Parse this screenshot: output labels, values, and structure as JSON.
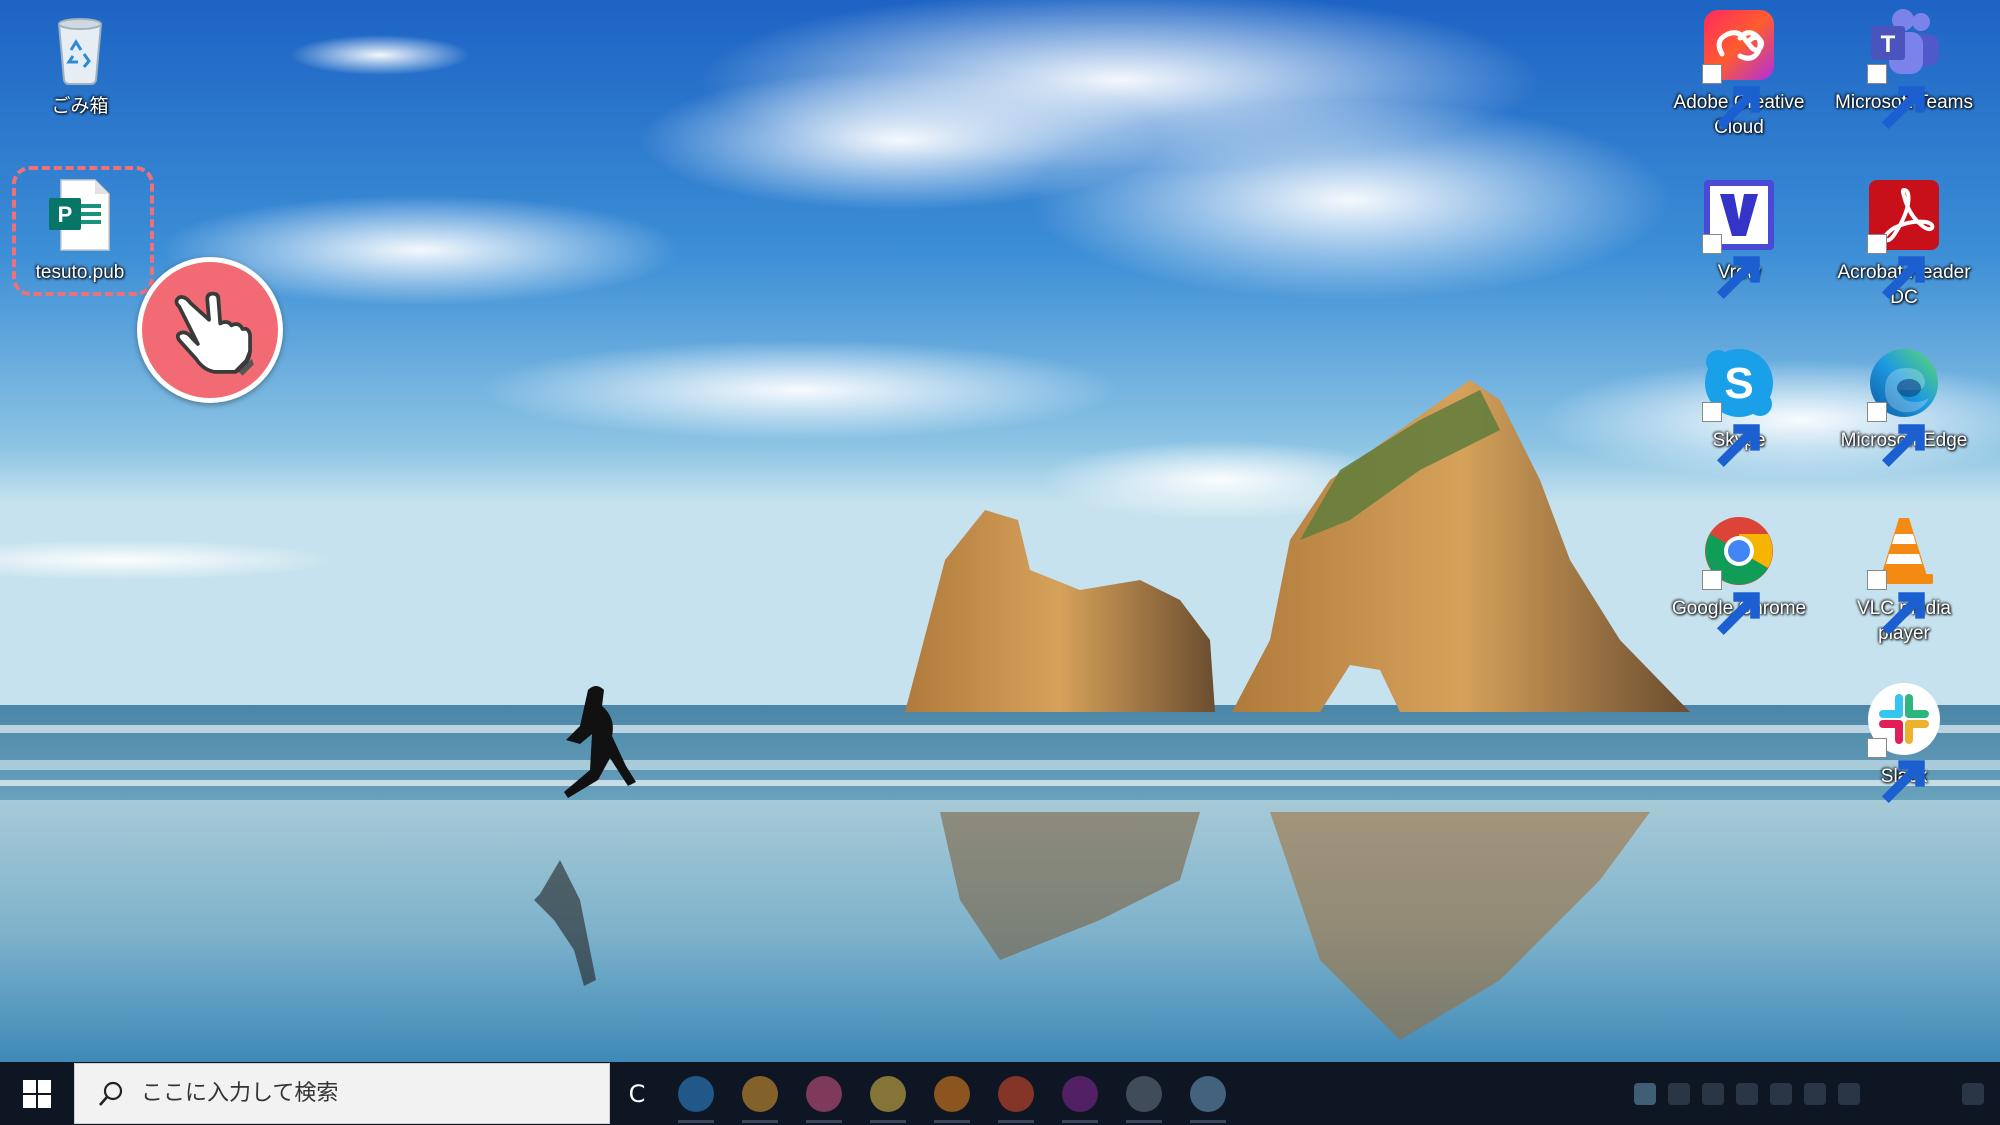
{
  "desktop": {
    "icons_left": [
      {
        "name": "recycle-bin",
        "label": "ごみ箱"
      },
      {
        "name": "tesuto-pub",
        "label": "tesuto.pub"
      }
    ],
    "icons_right": [
      {
        "name": "adobe-creative-cloud",
        "label": "Adobe Creative Cloud"
      },
      {
        "name": "microsoft-teams",
        "label": "Microsoft Teams"
      },
      {
        "name": "vrew",
        "label": "Vrew"
      },
      {
        "name": "acrobat-reader-dc",
        "label": "Acrobat Reader DC"
      },
      {
        "name": "skype",
        "label": "Skype"
      },
      {
        "name": "microsoft-edge",
        "label": "Microsoft Edge"
      },
      {
        "name": "google-chrome",
        "label": "Google Chrome"
      },
      {
        "name": "vlc-media-player",
        "label": "VLC media player"
      },
      {
        "name": "slack",
        "label": "Slack"
      }
    ]
  },
  "taskbar": {
    "search_placeholder": "ここに入力して検索",
    "task_view_glyph": "C",
    "apps": [
      {
        "name": "edge",
        "color": "#2f8fe0"
      },
      {
        "name": "chrome",
        "color": "#e4a032"
      },
      {
        "name": "paint",
        "color": "#d85a8a"
      },
      {
        "name": "explorer",
        "color": "#e8c34a"
      },
      {
        "name": "vlc",
        "color": "#f08a1e"
      },
      {
        "name": "office",
        "color": "#e6502e"
      },
      {
        "name": "onenote",
        "color": "#8a2a9a"
      },
      {
        "name": "generic",
        "color": "#6c7a8a"
      },
      {
        "name": "network",
        "color": "#6fa3c8"
      }
    ]
  },
  "colors": {
    "highlight": "#f26a74",
    "taskbar_bg": "#0e1623"
  }
}
